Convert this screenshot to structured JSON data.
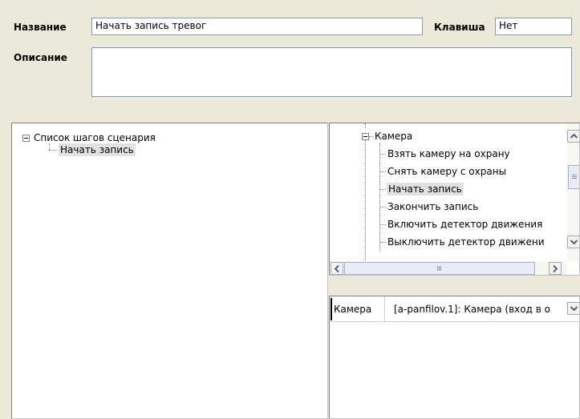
{
  "header": {
    "name_label": "Название",
    "name_value": "Начать запись тревог",
    "key_label": "Клавиша",
    "key_value": "Нет",
    "description_label": "Описание",
    "description_value": ""
  },
  "steps_tree": {
    "root_label": "Список шагов сценария",
    "children": [
      "Начать запись"
    ]
  },
  "actions_tree": {
    "root_label": "Камера",
    "items": [
      "Взять камеру на охрану",
      "Снять камеру с охраны",
      "Начать запись",
      "Закончить запись",
      "Включить детектор движения",
      "Выключить детектор движени"
    ],
    "selected_index": 2
  },
  "properties": {
    "row_label": "Камера",
    "row_value": "[a-panfilov.1]: Камера (вход в о"
  },
  "icons": {
    "collapse": "minus-box-icon",
    "scroll_up": "arrow-up-icon",
    "scroll_down": "arrow-down-icon",
    "scroll_left": "arrow-left-icon",
    "scroll_right": "arrow-right-icon",
    "dropdown": "chevron-down-icon"
  }
}
